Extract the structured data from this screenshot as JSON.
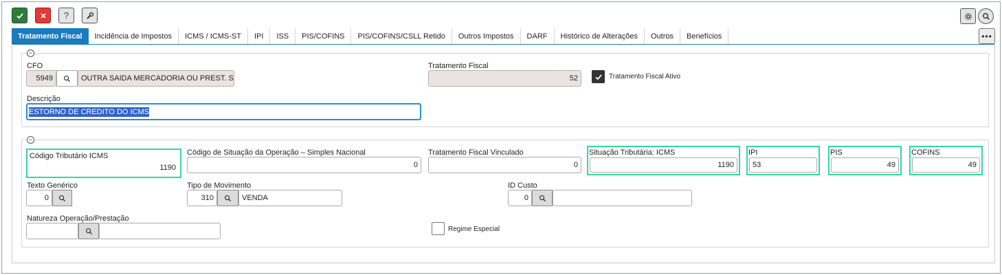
{
  "toolbar": {
    "ok_icon": "check-icon",
    "cancel_icon": "close-icon",
    "help_label": "?",
    "tool_icon": "wrench-icon",
    "settings_icon": "gear-icon",
    "search_icon": "search-icon",
    "more_label": "•••"
  },
  "tabs": [
    {
      "label": "Tratamento Fiscal",
      "active": true
    },
    {
      "label": "Incidência de Impostos"
    },
    {
      "label": "ICMS / ICMS-ST"
    },
    {
      "label": "IPI"
    },
    {
      "label": "ISS"
    },
    {
      "label": "PIS/COFINS"
    },
    {
      "label": "PIS/COFINS/CSLL Retido"
    },
    {
      "label": "Outros Impostos"
    },
    {
      "label": "DARF"
    },
    {
      "label": "Histórico de Alterações"
    },
    {
      "label": "Outros"
    },
    {
      "label": "Benefícios"
    }
  ],
  "section1": {
    "cfo_label": "CFO",
    "cfo_code": "5949",
    "cfo_desc": "OUTRA SAIDA MERCADORIA OU PREST. SERVICO",
    "tratamento_label": "Tratamento Fiscal",
    "tratamento_value": "52",
    "ativo_label": "Tratamento Fiscal Ativo",
    "ativo_checked": true,
    "descricao_label": "Descrição",
    "descricao_value": "ESTORNO DE CREDITO DO ICMS"
  },
  "section2": {
    "cod_trib_label": "Código Tributário ICMS",
    "cod_trib_value": "1190",
    "csosn_label": "Código de Situação da Operação – Simples Nacional",
    "csosn_value": "0",
    "vinculado_label": "Tratamento Fiscal Vinculado",
    "vinculado_value": "0",
    "sit_icms_label": "Situação Tributária: ICMS",
    "sit_icms_value": "1190",
    "ipi_label": "IPI",
    "ipi_value": "53",
    "pis_label": "PIS",
    "pis_value": "49",
    "cofins_label": "COFINS",
    "cofins_value": "49",
    "texto_label": "Texto Genérico",
    "texto_value": "0",
    "movimento_label": "Tipo de Movimento",
    "movimento_code": "310",
    "movimento_desc": "VENDA",
    "custo_label": "ID Custo",
    "custo_value": "0",
    "natureza_label": "Natureza Operação/Prestação",
    "natureza_value": "",
    "regime_label": "Regime Especial",
    "regime_checked": false
  },
  "colors": {
    "accent": "#1a7bbf",
    "highlight": "#33d6a3",
    "ok": "#2f7d3d",
    "cancel": "#e53935"
  }
}
